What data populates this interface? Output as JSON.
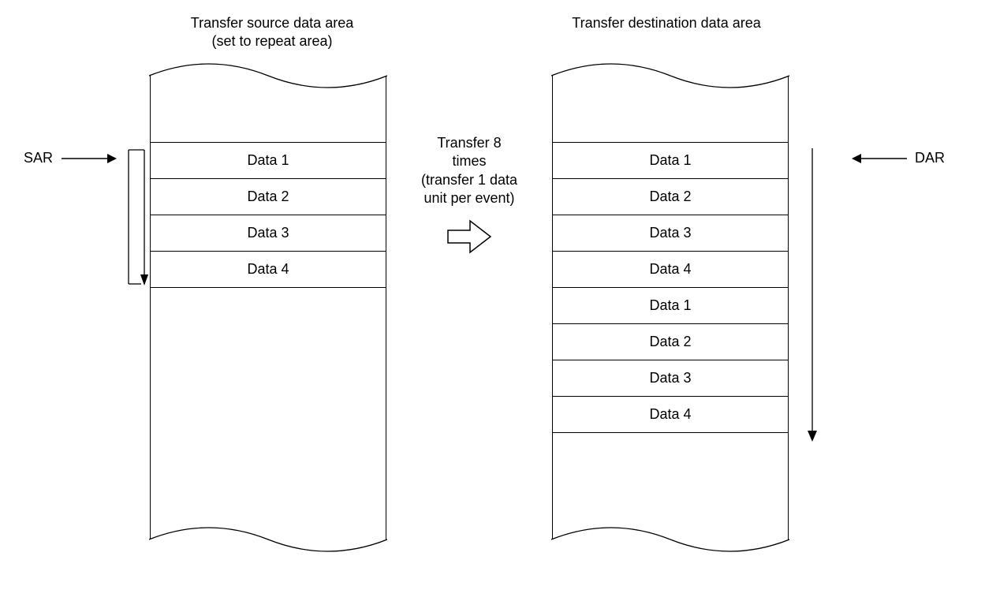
{
  "diagram": {
    "source": {
      "title_line1": "Transfer source data area",
      "title_line2": "(set to repeat area)",
      "pointer_label": "SAR",
      "rows": [
        "Data 1",
        "Data 2",
        "Data 3",
        "Data 4"
      ]
    },
    "destination": {
      "title_line1": "Transfer destination data area",
      "pointer_label": "DAR",
      "rows": [
        "Data 1",
        "Data 2",
        "Data 3",
        "Data 4",
        "Data 1",
        "Data 2",
        "Data 3",
        "Data 4"
      ]
    },
    "transfer_note": {
      "line1": "Transfer 8",
      "line2": "times",
      "line3": "(transfer 1 data",
      "line4": "unit per event)"
    }
  }
}
